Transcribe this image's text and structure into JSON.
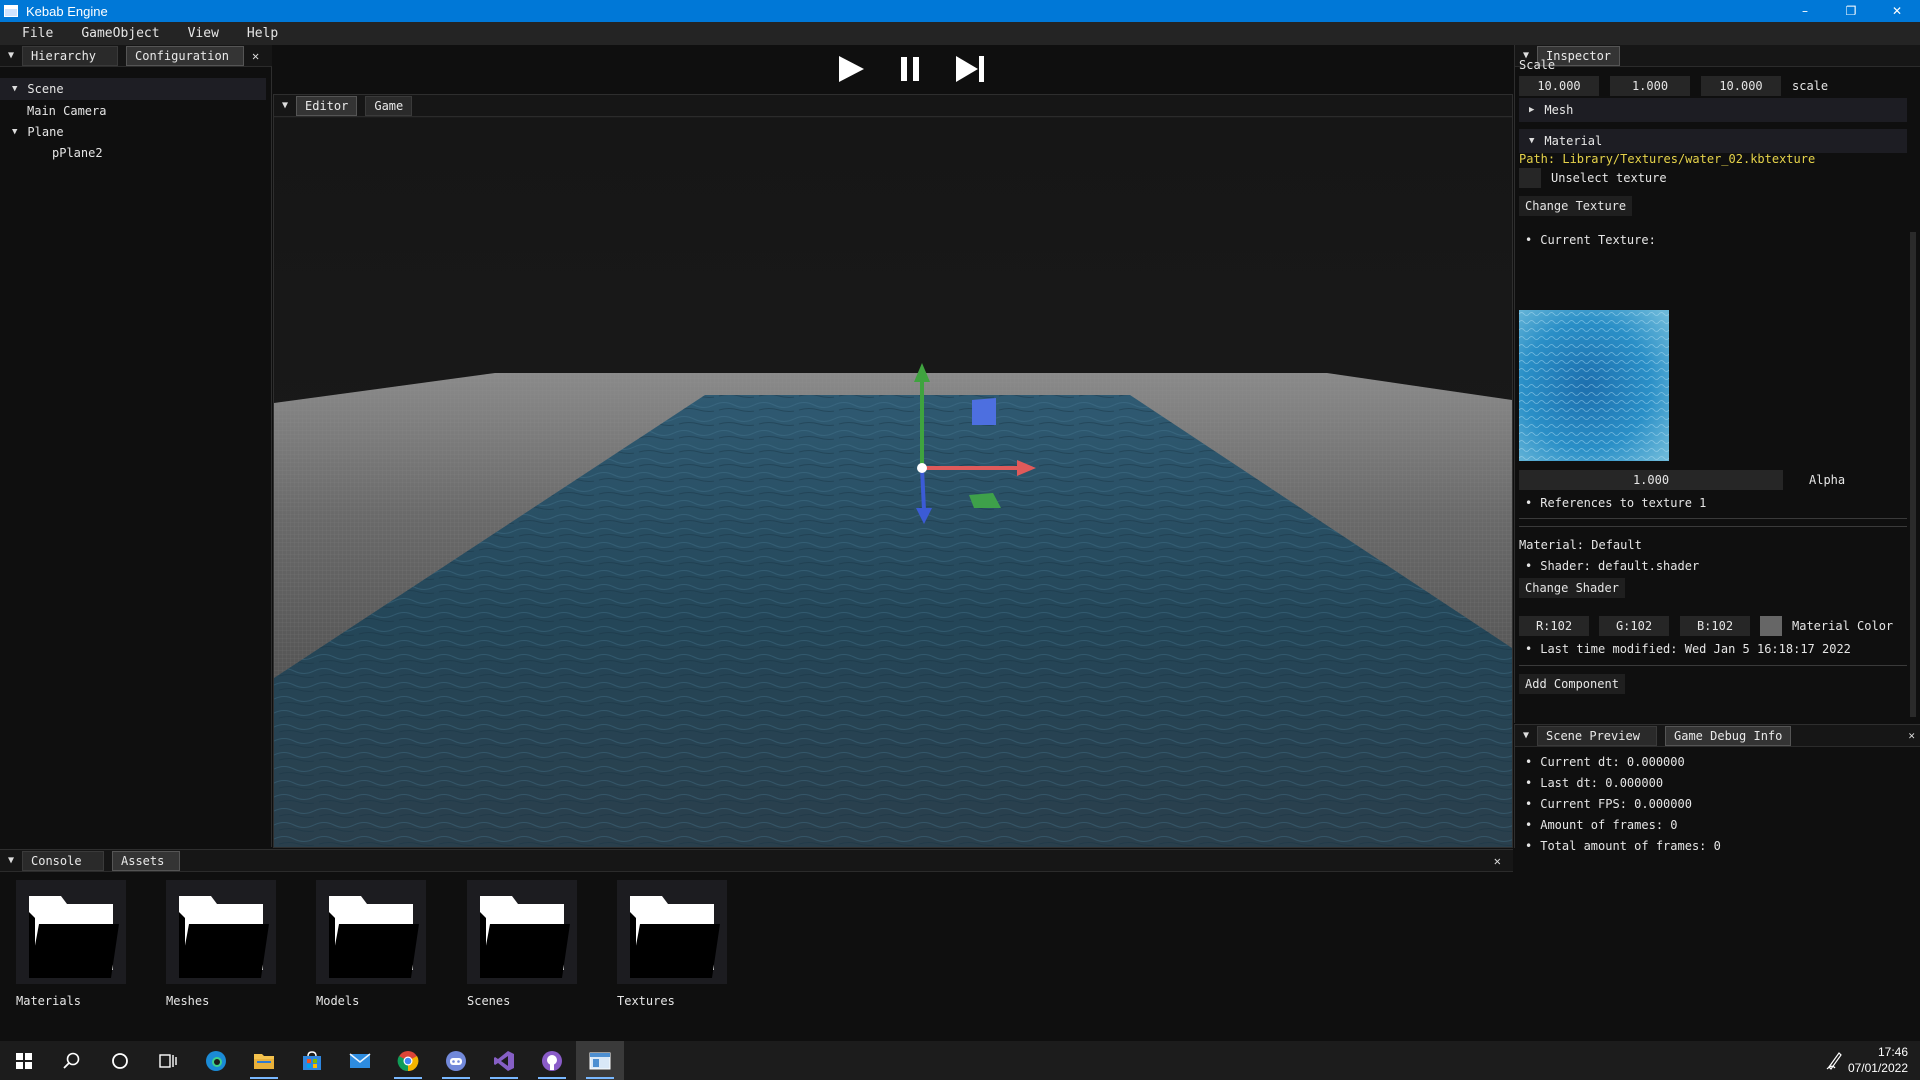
{
  "window": {
    "title": "Kebab Engine",
    "minimize": "–",
    "maximize": "❐",
    "close": "✕"
  },
  "menu": [
    "File",
    "GameObject",
    "View",
    "Help"
  ],
  "left_panel": {
    "tabs": [
      "Hierarchy",
      "Configuration"
    ],
    "close": "✕",
    "tree": {
      "scene": "Scene",
      "main_camera": "Main Camera",
      "plane": "Plane",
      "pplane2": "pPlane2"
    }
  },
  "toolbar": {
    "play": "play-icon",
    "pause": "pause-icon",
    "step": "step-icon"
  },
  "viewport": {
    "tabs": [
      "Editor",
      "Game"
    ]
  },
  "inspector": {
    "tab": "Inspector",
    "scale_label": "Scale",
    "scale_values": [
      "10.000",
      "1.000",
      "10.000"
    ],
    "scale_suffix": "scale",
    "mesh_header": "Mesh",
    "material_header": "Material",
    "path": "Path: Library/Textures/water_02.kbtexture",
    "unselect_texture": "Unselect texture",
    "change_texture": "Change Texture",
    "current_texture": "Current Texture:",
    "alpha_value": "1.000",
    "alpha_label": "Alpha",
    "references": "References to texture 1",
    "material_name": "Material: Default",
    "shader": "Shader: default.shader",
    "change_shader": "Change Shader",
    "color_r": "R:102",
    "color_g": "G:102",
    "color_b": "B:102",
    "material_color": "Material Color",
    "last_modified": "Last time modified: Wed Jan  5 16:18:17 2022",
    "add_component": "Add Component",
    "path_color": "#e6d34a"
  },
  "debug_panel": {
    "tabs": [
      "Scene Preview",
      "Game Debug Info"
    ],
    "close": "✕",
    "current_dt": "Current dt: 0.000000",
    "last_dt": "Last dt: 0.000000",
    "current_fps": "Current FPS: 0.000000",
    "frames": "Amount of frames: 0",
    "total_frames": "Total amount of frames: 0"
  },
  "bottom_panel": {
    "tabs": [
      "Console",
      "Assets"
    ],
    "close": "✕",
    "folders": [
      "Materials",
      "Meshes",
      "Models",
      "Scenes",
      "Textures"
    ]
  },
  "taskbar": {
    "icons": [
      "windows-start-icon",
      "search-icon",
      "cortana-icon",
      "task-view-icon",
      "edge-icon",
      "file-explorer-icon",
      "store-icon",
      "mail-icon",
      "chrome-icon",
      "discord-icon",
      "visual-studio-icon",
      "github-icon",
      "kebab-engine-icon"
    ],
    "time": "17:46",
    "date": "07/01/2022"
  },
  "colors": {
    "titlebar": "#0078d7",
    "gizmo_x": "#e05a5a",
    "gizmo_y": "#3fa33f",
    "gizmo_z": "#3b5bd6",
    "water": "#264a5e"
  }
}
